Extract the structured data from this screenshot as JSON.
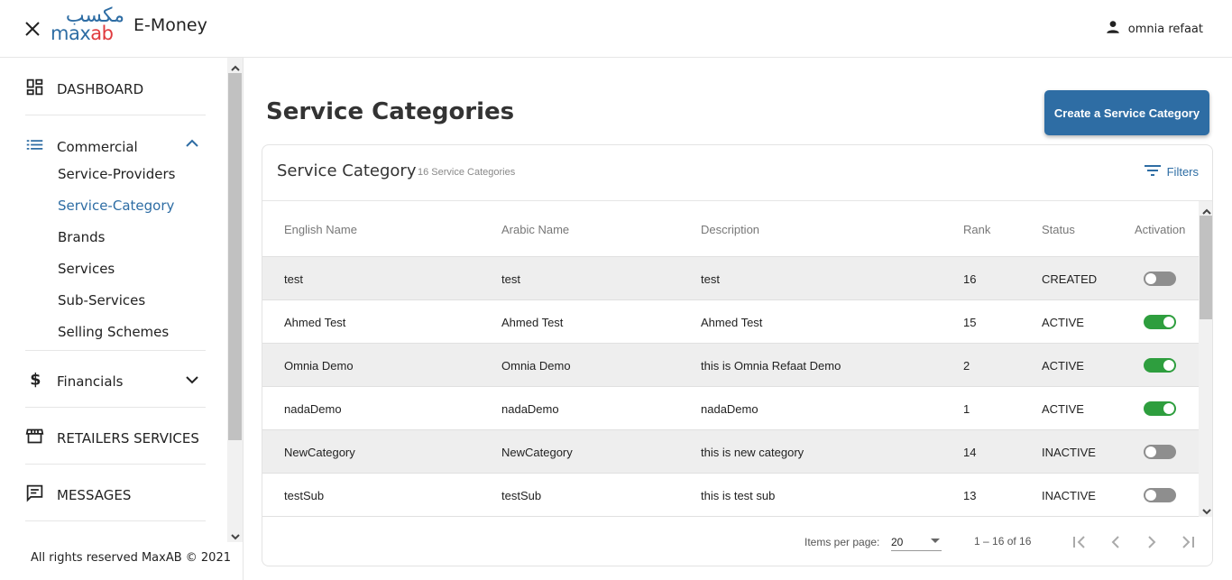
{
  "header": {
    "logo_arabic": "مكسب",
    "logo_latin_a": "max",
    "logo_latin_b": "ab",
    "app_title": "E-Money",
    "user_name": "omnia refaat"
  },
  "sidebar": {
    "dashboard": "DASHBOARD",
    "commercial": "Commercial",
    "sub_items": [
      "Service-Providers",
      "Service-Category",
      "Brands",
      "Services",
      "Sub-Services",
      "Selling Schemes"
    ],
    "financials": "Financials",
    "retailers": "RETAILERS SERVICES",
    "messages": "MESSAGES",
    "copyright": "All rights reserved MaxAB © 2021"
  },
  "page": {
    "title": "Service Categories",
    "create_button": "Create a Service Category"
  },
  "card": {
    "title": "Service Category",
    "count": "16 Service Categories",
    "filters": "Filters"
  },
  "table": {
    "headers": [
      "English Name",
      "Arabic Name",
      "Description",
      "Rank",
      "Status",
      "Activation"
    ],
    "rows": [
      {
        "english": "test",
        "arabic": "test",
        "description": "test",
        "rank": "16",
        "status": "CREATED",
        "active": false
      },
      {
        "english": "Ahmed Test",
        "arabic": "Ahmed Test",
        "description": "Ahmed Test",
        "rank": "15",
        "status": "ACTIVE",
        "active": true
      },
      {
        "english": "Omnia Demo",
        "arabic": "Omnia Demo",
        "description": "this is Omnia Refaat Demo",
        "rank": "2",
        "status": "ACTIVE",
        "active": true
      },
      {
        "english": "nadaDemo",
        "arabic": "nadaDemo",
        "description": "nadaDemo",
        "rank": "1",
        "status": "ACTIVE",
        "active": true
      },
      {
        "english": "NewCategory",
        "arabic": "NewCategory",
        "description": "this is new category",
        "rank": "14",
        "status": "INACTIVE",
        "active": false
      },
      {
        "english": "testSub",
        "arabic": "testSub",
        "description": "this is test sub",
        "rank": "13",
        "status": "INACTIVE",
        "active": false
      }
    ]
  },
  "paginator": {
    "items_per_page_label": "Items per page:",
    "items_per_page_value": "20",
    "range": "1 – 16 of 16"
  },
  "colors": {
    "primary": "#2e6da4",
    "toggle_on": "#2e9e3e",
    "toggle_off": "#8e8e8e",
    "logo_accent": "#e03a3e"
  }
}
